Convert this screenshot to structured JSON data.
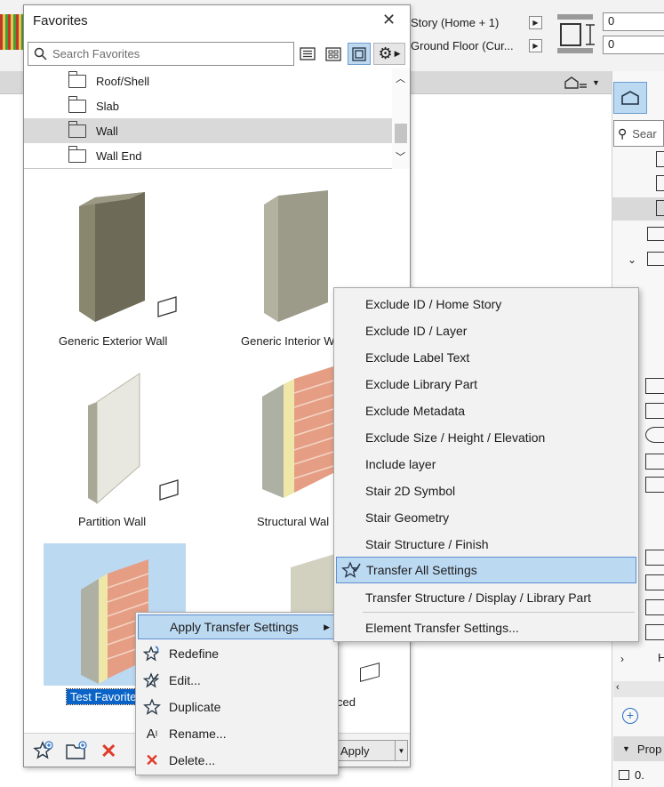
{
  "app": {
    "story_top": "Story (Home + 1)",
    "story_bottom": "Ground Floor (Cur...",
    "offset_top_value": "0",
    "offset_bottom_value": "0",
    "right_search_placeholder": "Sear",
    "right_panel_partial": "Prop",
    "right_tree_partial_h": "H",
    "right_bottom_value": "0."
  },
  "favorites": {
    "title": "Favorites",
    "search_placeholder": "Search Favorites",
    "folders": [
      {
        "label": "Roof/Shell",
        "selected": false
      },
      {
        "label": "Slab",
        "selected": false
      },
      {
        "label": "Wall",
        "selected": true
      },
      {
        "label": "Wall End",
        "selected": false
      }
    ],
    "tiles": [
      {
        "label": "Generic Exterior Wall",
        "style": "exterior"
      },
      {
        "label": "Generic Interior W",
        "style": "interior"
      },
      {
        "label": "Partition Wall",
        "style": "partition"
      },
      {
        "label": "Structural Wal",
        "style": "brick"
      },
      {
        "label": "Test Favorite",
        "style": "brick",
        "selected": true
      },
      {
        "label": "ced",
        "style": "concrete"
      }
    ],
    "apply_label": "Apply"
  },
  "context_menu": {
    "items": [
      {
        "label": "Apply Transfer Settings",
        "icon": "none",
        "highlighted": true,
        "submenu": true
      },
      {
        "label": "Redefine",
        "icon": "star-redefine-icon"
      },
      {
        "label": "Edit...",
        "icon": "star-edit-icon"
      },
      {
        "label": "Duplicate",
        "icon": "star-icon"
      },
      {
        "label": "Rename...",
        "icon": "rename-icon"
      },
      {
        "label": "Delete...",
        "icon": "red-x-icon"
      }
    ]
  },
  "submenu": {
    "items": [
      {
        "label": "Exclude ID / Home Story"
      },
      {
        "label": "Exclude ID / Layer"
      },
      {
        "label": "Exclude Label Text"
      },
      {
        "label": "Exclude Library Part"
      },
      {
        "label": "Exclude Metadata"
      },
      {
        "label": "Exclude Size / Height / Elevation"
      },
      {
        "label": "Include layer"
      },
      {
        "label": "Stair 2D Symbol"
      },
      {
        "label": "Stair Geometry"
      },
      {
        "label": "Stair Structure / Finish"
      },
      {
        "label": "Transfer All Settings",
        "highlighted": true,
        "icon": "star-check-icon"
      },
      {
        "label": "Transfer Structure / Display / Library Part"
      }
    ],
    "footer": "Element Transfer Settings..."
  },
  "colors": {
    "accent": "#0a64c8",
    "highlight": "#bcd9f2",
    "delete_red": "#e03a28"
  }
}
